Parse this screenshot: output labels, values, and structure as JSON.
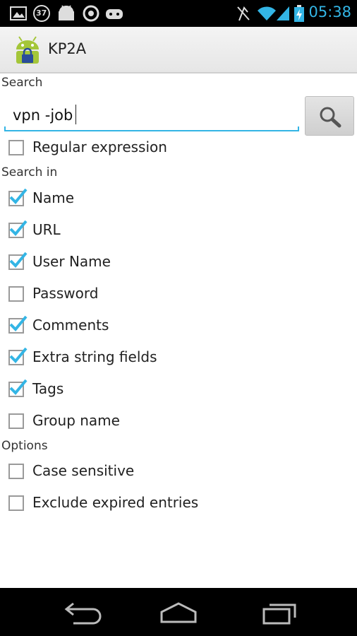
{
  "status_bar": {
    "time": "05:38",
    "notification_badge": "37",
    "icons": [
      "image-icon",
      "badge-37-icon",
      "android-robot-icon",
      "keepass-icon",
      "gamepad-icon",
      "no-sim-icon",
      "wifi-icon",
      "signal-icon",
      "battery-charging-icon"
    ],
    "accent_color": "#33b5e5"
  },
  "action_bar": {
    "title": "KP2A"
  },
  "search": {
    "section_label": "Search",
    "query": "vpn -job",
    "button_icon": "magnifier-icon",
    "regex_label": "Regular expression",
    "regex_checked": false
  },
  "search_in": {
    "section_label": "Search in",
    "items": [
      {
        "label": "Name",
        "checked": true
      },
      {
        "label": "URL",
        "checked": true
      },
      {
        "label": "User Name",
        "checked": true
      },
      {
        "label": "Password",
        "checked": false
      },
      {
        "label": "Comments",
        "checked": true
      },
      {
        "label": "Extra string fields",
        "checked": true
      },
      {
        "label": "Tags",
        "checked": true
      },
      {
        "label": "Group name",
        "checked": false
      }
    ]
  },
  "options": {
    "section_label": "Options",
    "items": [
      {
        "label": "Case sensitive",
        "checked": false
      },
      {
        "label": "Exclude expired entries",
        "checked": false
      }
    ]
  },
  "nav_bar": {
    "icons": [
      "back-icon",
      "home-icon",
      "recent-apps-icon"
    ]
  }
}
